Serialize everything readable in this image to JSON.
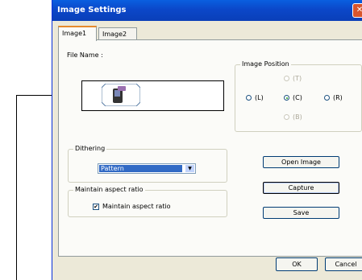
{
  "window": {
    "title": "Image Settings",
    "close_symbol": "✕"
  },
  "tabs": [
    {
      "label": "Image1"
    },
    {
      "label": "Image2"
    }
  ],
  "file_name_label": "File Name :",
  "image_position": {
    "title": "Image Position",
    "options": {
      "top": "(T)",
      "left": "(L)",
      "center": "(C)",
      "right": "(R)",
      "bottom": "(B)"
    },
    "selected": "center"
  },
  "dithering": {
    "title": "Dithering",
    "value": "Pattern",
    "arrow": "▼"
  },
  "aspect": {
    "title": "Maintain aspect ratio",
    "checkbox_label": "Maintain aspect ratio",
    "checked": "✔"
  },
  "buttons": {
    "open": "Open Image",
    "capture": "Capture",
    "save": "Save",
    "ok": "OK",
    "cancel": "Cancel"
  },
  "colors": {
    "titlebar": "#0b47c9",
    "selection": "#316ac5",
    "panel": "#fbfbf8",
    "dialog": "#ece9d8"
  }
}
